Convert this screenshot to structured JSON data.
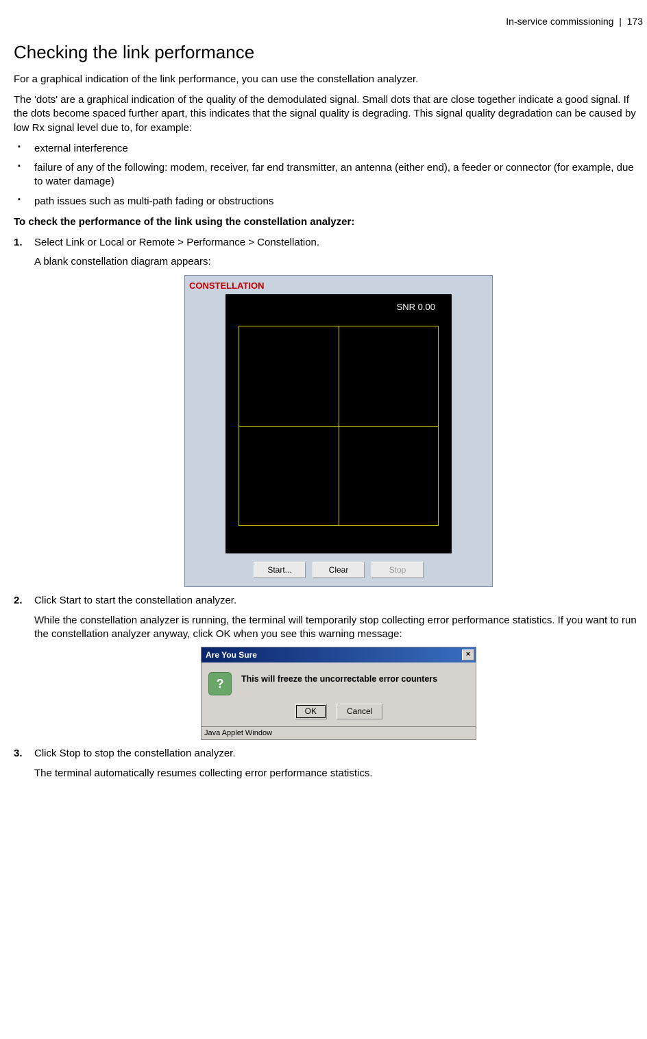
{
  "header": {
    "section": "In-service commissioning",
    "sep": "|",
    "page": "173"
  },
  "title": "Checking the link performance",
  "para1": "For a graphical indication of the link performance, you can use the constellation analyzer.",
  "para2": "The 'dots' are a graphical indication of the quality of the demodulated signal. Small dots that are close together indicate a good signal. If the dots become spaced further apart, this indicates that the signal quality is degrading. This signal quality degradation can be caused by low Rx signal level due to, for example:",
  "bullets": [
    "external interference",
    "failure of any of the following: modem, receiver, far end transmitter, an antenna (either end), a feeder or connector (for example, due to water damage)",
    "path issues such as multi-path fading or obstructions"
  ],
  "lead_bold": "To check the performance of the link using the constellation analyzer:",
  "steps": {
    "s1num": "1.",
    "s1a": "Select Link or Local or Remote > Performance > Constellation.",
    "s1b": "A blank constellation diagram appears:",
    "s2num": "2.",
    "s2a": "Click Start to start the constellation analyzer.",
    "s2b": "While the constellation analyzer is running, the terminal will temporarily stop collecting error performance statistics. If you want to run the constellation analyzer anyway, click OK when you see this warning message:",
    "s3num": "3.",
    "s3a": "Click Stop to stop the constellation analyzer.",
    "s3b": "The terminal automatically resumes collecting error performance statistics."
  },
  "constellation": {
    "title": "CONSTELLATION",
    "snr": "SNR 0.00",
    "buttons": {
      "start": "Start...",
      "clear": "Clear",
      "stop": "Stop"
    }
  },
  "dialog": {
    "title": "Are You Sure",
    "msg": "This will freeze the uncorrectable error counters",
    "ok": "OK",
    "cancel": "Cancel",
    "status": "Java Applet Window",
    "qmark": "?"
  }
}
